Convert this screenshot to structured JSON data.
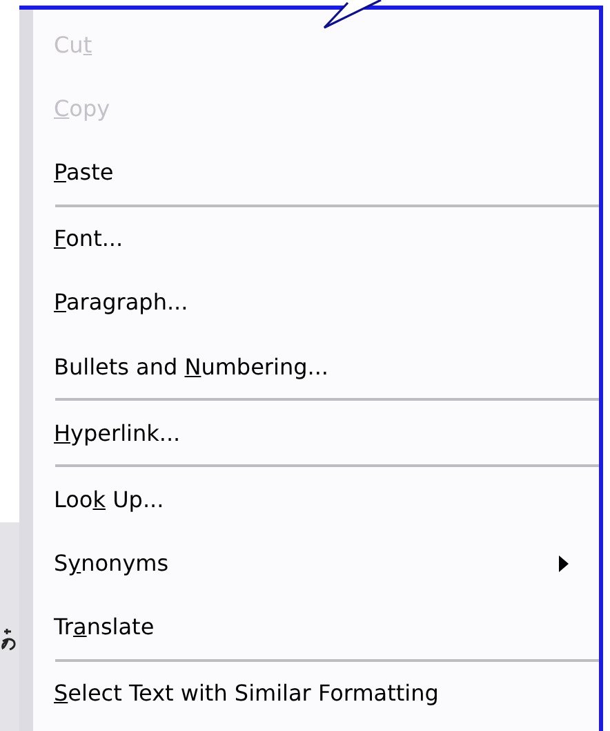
{
  "menu": {
    "items": [
      {
        "kind": "item",
        "disabled": true,
        "label": [
          {
            "text": "Cu",
            "underlined": false
          },
          {
            "text": "t",
            "underlined": true
          }
        ]
      },
      {
        "kind": "item",
        "disabled": true,
        "label": [
          {
            "text": "C",
            "underlined": true
          },
          {
            "text": "opy",
            "underlined": false
          }
        ]
      },
      {
        "kind": "item",
        "disabled": false,
        "label": [
          {
            "text": "P",
            "underlined": true
          },
          {
            "text": "aste",
            "underlined": false
          }
        ]
      },
      {
        "kind": "separator"
      },
      {
        "kind": "item",
        "disabled": false,
        "label": [
          {
            "text": "F",
            "underlined": true
          },
          {
            "text": "ont...",
            "underlined": false
          }
        ]
      },
      {
        "kind": "item",
        "disabled": false,
        "label": [
          {
            "text": "P",
            "underlined": true
          },
          {
            "text": "aragraph...",
            "underlined": false
          }
        ]
      },
      {
        "kind": "item",
        "disabled": false,
        "label": [
          {
            "text": "Bullets and ",
            "underlined": false
          },
          {
            "text": "N",
            "underlined": true
          },
          {
            "text": "umbering...",
            "underlined": false
          }
        ]
      },
      {
        "kind": "separator"
      },
      {
        "kind": "item",
        "disabled": false,
        "label": [
          {
            "text": "H",
            "underlined": true
          },
          {
            "text": "yperlink...",
            "underlined": false
          }
        ]
      },
      {
        "kind": "separator"
      },
      {
        "kind": "item",
        "disabled": false,
        "label": [
          {
            "text": "Loo",
            "underlined": false
          },
          {
            "text": "k",
            "underlined": true
          },
          {
            "text": " Up...",
            "underlined": false
          }
        ]
      },
      {
        "kind": "submenu",
        "disabled": false,
        "label": [
          {
            "text": "S",
            "underlined": false
          },
          {
            "text": "y",
            "underlined": true
          },
          {
            "text": "nonyms",
            "underlined": false
          }
        ]
      },
      {
        "kind": "item",
        "disabled": false,
        "label": [
          {
            "text": "Tr",
            "underlined": false
          },
          {
            "text": "a",
            "underlined": true
          },
          {
            "text": "nslate",
            "underlined": false
          }
        ]
      },
      {
        "kind": "separator"
      },
      {
        "kind": "item",
        "disabled": false,
        "label": [
          {
            "text": "S",
            "underlined": true
          },
          {
            "text": "elect Text with Similar Formatting",
            "underlined": false
          }
        ]
      }
    ]
  }
}
